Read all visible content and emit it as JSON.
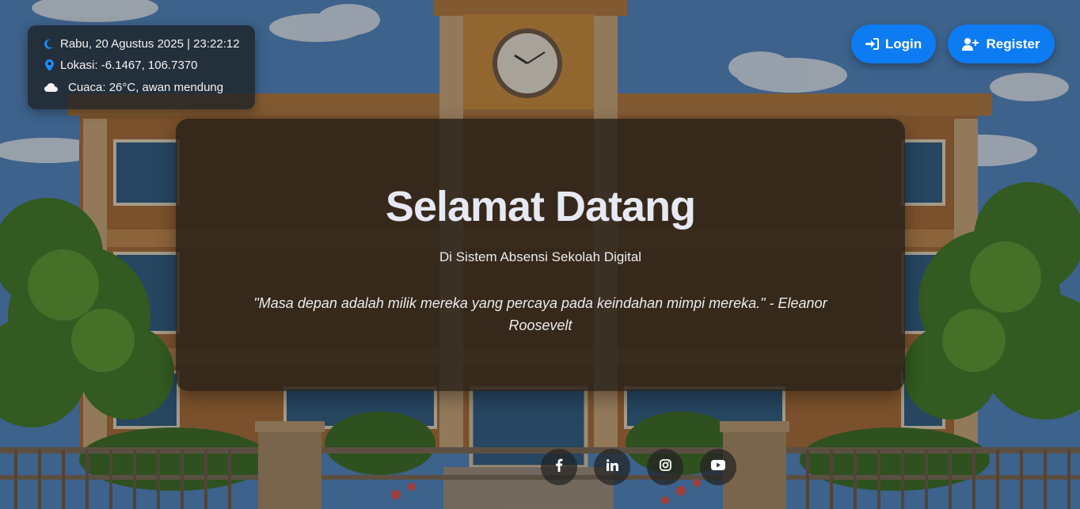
{
  "info": {
    "datetime": "Rabu, 20 Agustus 2025 | 23:22:12",
    "location": "Lokasi: -6.1467, 106.7370",
    "weather": "Cuaca: 26°C, awan mendung",
    "icons": [
      "moon-icon",
      "map-pin-icon",
      "cloud-icon"
    ]
  },
  "auth": {
    "login_label": "Login",
    "register_label": "Register",
    "button_color": "#0d7cf2"
  },
  "welcome": {
    "title": "Selamat Datang",
    "subtitle": "Di Sistem Absensi Sekolah Digital",
    "quote": "\"Masa depan adalah milik mereka yang percaya pada keindahan mimpi mereka.\" - Eleanor Roosevelt"
  },
  "social": [
    "facebook-icon",
    "linkedin-icon",
    "instagram-icon",
    "youtube-icon"
  ]
}
